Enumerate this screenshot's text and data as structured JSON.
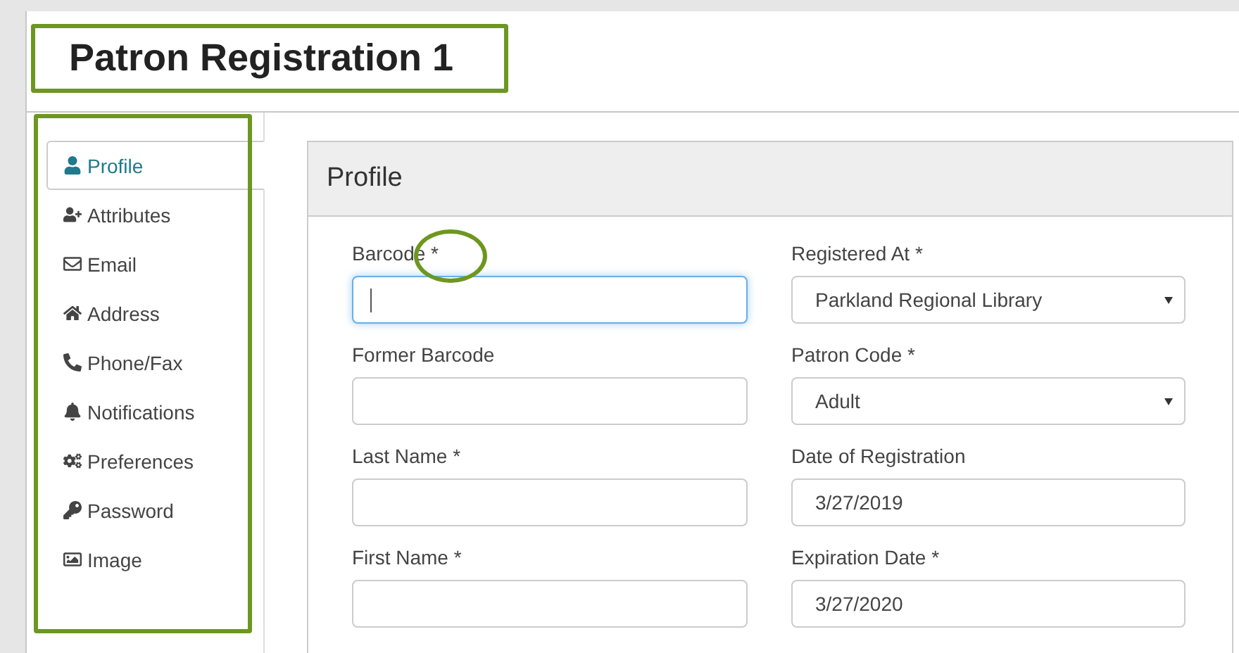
{
  "page": {
    "title": "Patron Registration 1"
  },
  "sidebar": {
    "items": [
      {
        "label": "Profile",
        "selected": true
      },
      {
        "label": "Attributes",
        "selected": false
      },
      {
        "label": "Email",
        "selected": false
      },
      {
        "label": "Address",
        "selected": false
      },
      {
        "label": "Phone/Fax",
        "selected": false
      },
      {
        "label": "Notifications",
        "selected": false
      },
      {
        "label": "Preferences",
        "selected": false
      },
      {
        "label": "Password",
        "selected": false
      },
      {
        "label": "Image",
        "selected": false
      }
    ]
  },
  "panel": {
    "title": "Profile",
    "fields": [
      {
        "label": "Barcode *",
        "kind": "text",
        "focused": true
      },
      {
        "label": "Registered At *",
        "kind": "select",
        "value": "Parkland Regional Library",
        "focused": false
      },
      {
        "label": "Former Barcode",
        "kind": "text",
        "focused": false
      },
      {
        "label": "Patron Code *",
        "kind": "select",
        "value": "Adult",
        "focused": false
      },
      {
        "label": "Last Name *",
        "kind": "text",
        "focused": false
      },
      {
        "label": "Date of Registration",
        "kind": "text",
        "value": "3/27/2019",
        "focused": false
      },
      {
        "label": "First Name *",
        "kind": "text",
        "focused": false
      },
      {
        "label": "Expiration Date *",
        "kind": "text",
        "value": "3/27/2020",
        "focused": false
      }
    ]
  }
}
